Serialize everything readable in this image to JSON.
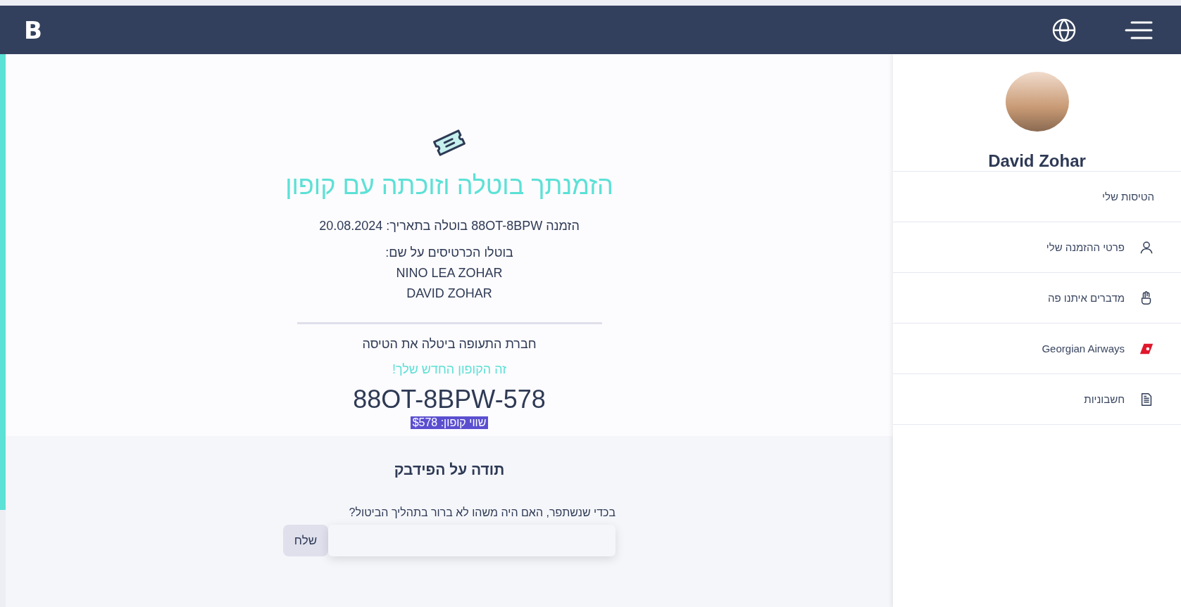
{
  "header": {
    "logo": "B"
  },
  "cancellation": {
    "title": "הזמנתך בוטלה וזוכתה עם קופון",
    "booking_line": "הזמנה 88OT-8BPW בוטלה בתאריך: 20.08.2024",
    "tickets_label": "בוטלו הכרטיסים על שם:",
    "passengers": [
      "NINO LEA ZOHAR",
      "DAVID ZOHAR"
    ],
    "reason": "חברת התעופה ביטלה את הטיסה",
    "coupon_intro": "זה הקופון החדש שלך!",
    "coupon_code": "88OT-8BPW-578",
    "coupon_value": "שווי קופון: $578"
  },
  "feedback": {
    "title": "תודה על הפידבק",
    "question": "בכדי שנשתפר, האם היה משהו לא ברור בתהליך הביטול?",
    "send_button": "שלח"
  },
  "sidebar": {
    "user_name": "David Zohar",
    "items": [
      {
        "label": "הטיסות שלי",
        "kind": "plain"
      },
      {
        "label": "פרטי ההזמנה שלי",
        "kind": "user"
      },
      {
        "label": "מדברים איתנו פה",
        "kind": "hand"
      },
      {
        "label": "Georgian Airways",
        "kind": "airline"
      },
      {
        "label": "חשבוניות",
        "kind": "document"
      }
    ]
  }
}
